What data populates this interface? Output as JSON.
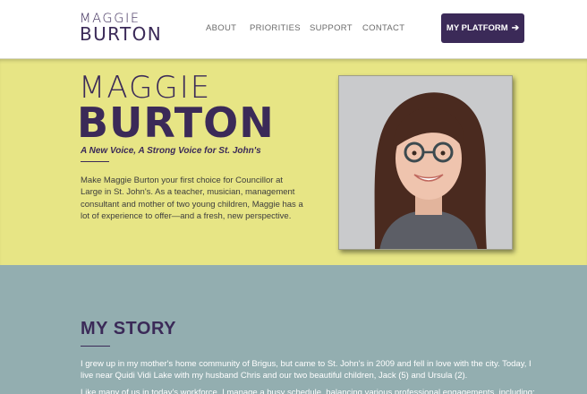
{
  "header": {
    "logo_first": "MAGGIE",
    "logo_last": "BURTON",
    "nav": [
      "ABOUT",
      "PRIORITIES",
      "SUPPORT",
      "CONTACT"
    ],
    "cta_label": "MY PLATFORM",
    "cta_icon": "arrow-right-icon"
  },
  "hero": {
    "first_name": "MAGGIE",
    "last_name": "BURTON",
    "tagline": "A New Voice, A Strong Voice for St. John's",
    "intro": "Make Maggie Burton your first choice for Councillor at Large in St. John's. As a teacher, musician, management consultant and mother of two young children, Maggie has a lot of experience to offer—and a fresh, new perspective."
  },
  "story": {
    "title": "MY STORY",
    "p1": "I grew up in my mother's home community of Brigus, but came to St. John's in 2009 and fell in love with the city. Today, I live near Quidi Vidi Lake with my husband Chris and our two beautiful children, Jack (5) and Ursula (2).",
    "p2": "Like many of us in today's workforce, I manage a busy schedule, balancing various professional engagements, including:"
  },
  "colors": {
    "brand_purple": "#3b2a58",
    "hero_yellow": "#e7e585",
    "story_teal": "#93aeb0"
  }
}
